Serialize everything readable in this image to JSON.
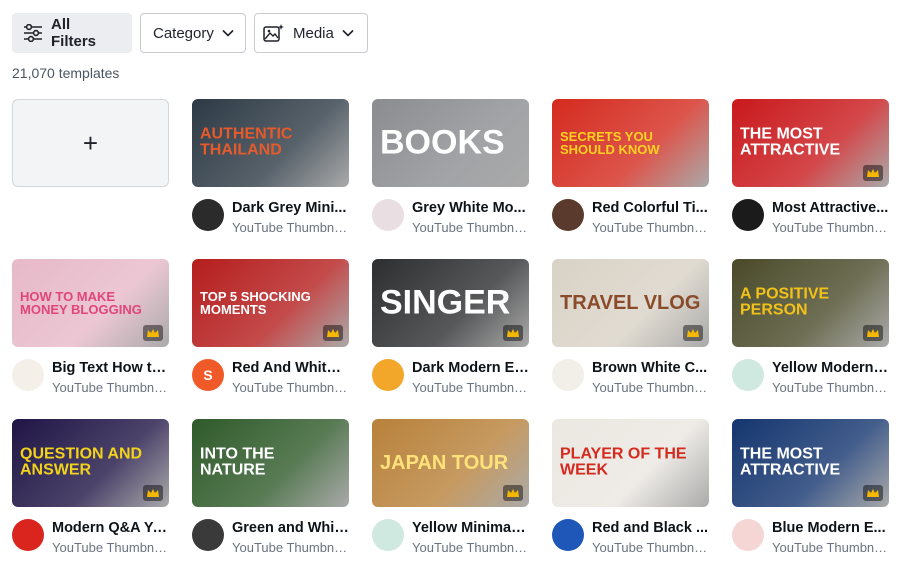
{
  "filters": {
    "all_filters": "All Filters",
    "category": "Category",
    "media": "Media"
  },
  "count": "21,070 templates",
  "create_symbol": "+",
  "templates": [
    {
      "title": "Dark Grey Mini...",
      "subtitle": "YouTube Thumbna...",
      "thumb_text": "AUTHENTIC THAILAND",
      "bg": "#2d3a45",
      "accent": "#e65a2b",
      "avatar_bg": "#2b2b2b",
      "avatar_text": "",
      "premium": false
    },
    {
      "title": "Grey White Mo...",
      "subtitle": "YouTube Thumbna...",
      "thumb_text": "BOOKS",
      "bg": "#8a8c90",
      "accent": "#ffffff",
      "avatar_bg": "#e9dfe3",
      "avatar_text": "",
      "premium": false
    },
    {
      "title": "Red Colorful Ti...",
      "subtitle": "YouTube Thumbna...",
      "thumb_text": "SECRETS YOU SHOULD KNOW",
      "bg": "#d42a1e",
      "accent": "#ffd21f",
      "avatar_bg": "#5a3a2c",
      "avatar_text": "",
      "premium": false
    },
    {
      "title": "Most Attractive...",
      "subtitle": "YouTube Thumbna...",
      "thumb_text": "THE MOST ATTRACTIVE",
      "bg": "#c9191c",
      "accent": "#ffffff",
      "avatar_bg": "#1b1b1b",
      "avatar_text": "",
      "premium": true
    },
    {
      "title": "Big Text How to...",
      "subtitle": "YouTube Thumbna...",
      "thumb_text": "HOW TO MAKE MONEY BLOGGING",
      "bg": "#e7b9c8",
      "accent": "#e0457b",
      "avatar_bg": "#f4efe9",
      "avatar_text": "",
      "premium": true
    },
    {
      "title": "Red And White ...",
      "subtitle": "YouTube Thumbna...",
      "thumb_text": "TOP 5 SHOCKING MOMENTS",
      "bg": "#b51d1d",
      "accent": "#ffffff",
      "avatar_bg": "#f05a28",
      "avatar_text": "S",
      "premium": true
    },
    {
      "title": "Dark Modern El...",
      "subtitle": "YouTube Thumbna...",
      "thumb_text": "SINGER",
      "bg": "#2d2e30",
      "accent": "#ffffff",
      "avatar_bg": "#f2a72b",
      "avatar_text": "",
      "premium": true
    },
    {
      "title": "Brown White C...",
      "subtitle": "YouTube Thumbna...",
      "thumb_text": "TRAVEL VLOG",
      "bg": "#d9d2c6",
      "accent": "#8a4b2a",
      "avatar_bg": "#f2eee8",
      "avatar_text": "",
      "premium": true
    },
    {
      "title": "Yellow Modern ...",
      "subtitle": "YouTube Thumbna...",
      "thumb_text": "A POSITIVE PERSON",
      "bg": "#4a4a2a",
      "accent": "#f2c21a",
      "avatar_bg": "#cfe8e0",
      "avatar_text": "",
      "premium": true
    },
    {
      "title": "Modern Q&A Yo...",
      "subtitle": "YouTube Thumbna...",
      "thumb_text": "QUESTION AND ANSWER",
      "bg": "#1f1445",
      "accent": "#f2d21a",
      "avatar_bg": "#d9251d",
      "avatar_text": "",
      "premium": true
    },
    {
      "title": "Green and Whit...",
      "subtitle": "YouTube Thumbna...",
      "thumb_text": "INTO THE NATURE",
      "bg": "#2f5a2a",
      "accent": "#ffffff",
      "avatar_bg": "#3a3a3a",
      "avatar_text": "",
      "premium": false
    },
    {
      "title": "Yellow Minimali...",
      "subtitle": "YouTube Thumbna...",
      "thumb_text": "JAPAN TOUR",
      "bg": "#b8813a",
      "accent": "#ffe27a",
      "avatar_bg": "#cfe8e0",
      "avatar_text": "",
      "premium": true
    },
    {
      "title": "Red and Black ...",
      "subtitle": "YouTube Thumbna...",
      "thumb_text": "PLAYER OF THE WEEK",
      "bg": "#ebe7e1",
      "accent": "#d42a1e",
      "avatar_bg": "#1f57b8",
      "avatar_text": "",
      "premium": false
    },
    {
      "title": "Blue Modern E...",
      "subtitle": "YouTube Thumbna...",
      "thumb_text": "THE MOST ATTRACTIVE",
      "bg": "#14356f",
      "accent": "#ffffff",
      "avatar_bg": "#f6d5d5",
      "avatar_text": "",
      "premium": true
    }
  ]
}
